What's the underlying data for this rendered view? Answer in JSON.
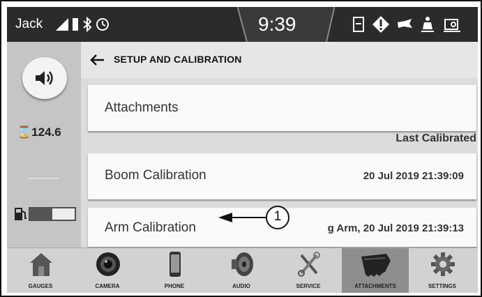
{
  "status_bar": {
    "user": "Jack",
    "time": "9:39",
    "icons": [
      "signal-icon",
      "battery-icon",
      "bluetooth-icon",
      "timer-icon",
      "maintenance-icon",
      "warning-icon",
      "hydraulic-icon",
      "seatbelt-icon",
      "engine-oil-icon"
    ]
  },
  "side_panel": {
    "volume_icon": "speaker-icon",
    "hour_meter": "⌛124.6",
    "fuel_icon": "fuel-pump-icon",
    "fuel_level": 0.5
  },
  "header": {
    "back_icon": "back-arrow-icon",
    "title": "SETUP AND CALIBRATION"
  },
  "rows": {
    "attachments": {
      "label": "Attachments"
    },
    "last_calibrated_label": "Last Calibrated",
    "boom": {
      "label": "Boom Calibration",
      "date": "20 Jul 2019 21:39:09"
    },
    "arm": {
      "label": "Arm Calibration",
      "date": "g Arm, 20 Jul 2019 21:39:13"
    }
  },
  "callout": {
    "number": "1"
  },
  "nav": {
    "items": [
      {
        "label": "GAUGES",
        "icon": "house-icon"
      },
      {
        "label": "CAMERA",
        "icon": "camera-icon"
      },
      {
        "label": "PHONE",
        "icon": "phone-icon"
      },
      {
        "label": "AUDIO",
        "icon": "speaker-icon"
      },
      {
        "label": "SERVICE",
        "icon": "wrench-icon"
      },
      {
        "label": "ATTACHMENTS",
        "icon": "bucket-icon"
      },
      {
        "label": "SETTINGS",
        "icon": "gear-icon"
      }
    ],
    "active": "ATTACHMENTS"
  }
}
